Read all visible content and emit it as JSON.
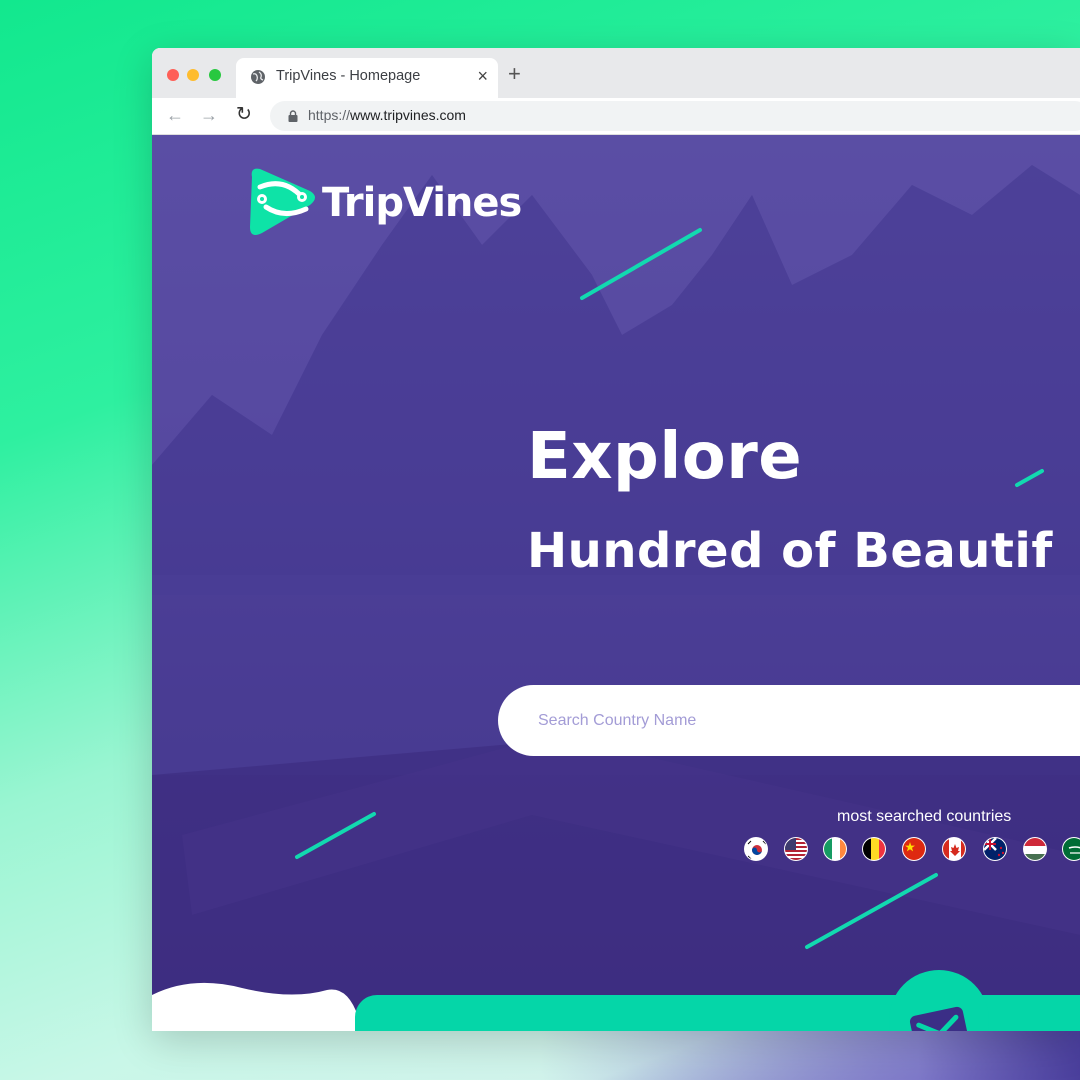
{
  "browser": {
    "tab_title": "TripVines - Homepage",
    "tab_close": "×",
    "new_tab": "+",
    "url_protocol": "https://",
    "url_host": "www.tripvines.com",
    "back": "←",
    "forward": "→",
    "reload": "↻"
  },
  "site": {
    "brand": "TripVines",
    "headline": "Explore",
    "subheadline": "Hundred of Beautif",
    "search_placeholder": "Search Country Name",
    "most_searched_label": "most searched countries",
    "flags": [
      "south-korea",
      "usa",
      "ireland",
      "belgium",
      "china",
      "canada",
      "new-zealand",
      "hungary",
      "saudi-arabia"
    ]
  },
  "colors": {
    "accent": "#05d6a8",
    "hero_purple": "#4e3f98",
    "background_green": "#12e88e"
  }
}
